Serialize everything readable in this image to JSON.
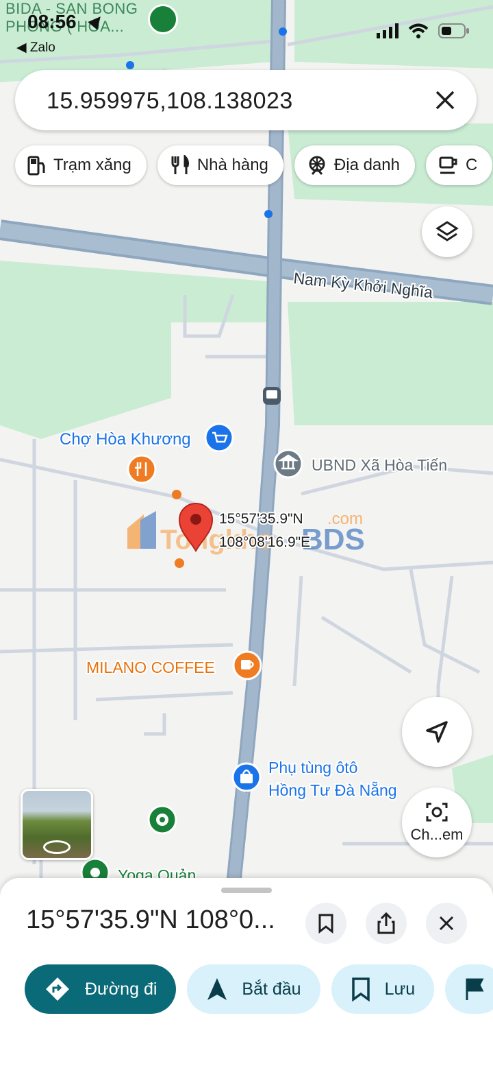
{
  "status_bar": {
    "time": "08:56",
    "back_app": "Zalo",
    "top_poi": [
      "BIDA - SAN BONG",
      "PHONG ( HOA..."
    ]
  },
  "search": {
    "value": "15.959975,108.138023"
  },
  "chips": [
    {
      "label": "Trạm xăng",
      "icon": "gas-station-icon"
    },
    {
      "label": "Nhà hàng",
      "icon": "restaurant-icon"
    },
    {
      "label": "Địa danh",
      "icon": "landmark-icon"
    },
    {
      "label": "C",
      "icon": "cafe-icon"
    }
  ],
  "map": {
    "road_label": "Nam Kỳ Khởi Nghĩa",
    "pin_label": [
      "15°57'35.9\"N",
      "108°08'16.9\"E"
    ],
    "places": [
      {
        "name": "Chợ Hòa Khương",
        "icon": "shopping-cart-icon",
        "color": "#1a73e8"
      },
      {
        "name": "UBND Xã Hòa Tiến",
        "icon": "government-building-icon",
        "color": "#5f6b73"
      },
      {
        "name": "MILANO COFFEE",
        "icon": "coffee-cup-icon",
        "color": "#e8710a"
      },
      {
        "name": "Phụ tùng ôtô",
        "name2": "Hồng Tư Đà Nẵng",
        "icon": "shopping-bag-icon",
        "color": "#1a73e8"
      },
      {
        "name": "Yoga Quản",
        "icon": "place-icon",
        "color": "#188038"
      }
    ],
    "watermark": {
      "left": "Tongkho",
      "right": "BDS",
      "suffix": ".com"
    },
    "colors": {
      "road": "#9fb3c8",
      "land": "#f3f3f1",
      "park": "#c9ecd3",
      "minor_road": "#cfd6e0"
    }
  },
  "controls": {
    "layers": "layers-icon",
    "locate": "navigation-arrow-icon",
    "lens_label": "Ch...em"
  },
  "sheet": {
    "title": "15°57'35.9\"N 108°0...",
    "buttons": [
      {
        "label": "Đường đi",
        "icon": "directions-icon"
      },
      {
        "label": "Bắt đầu",
        "icon": "start-navigation-icon"
      },
      {
        "label": "Lưu",
        "icon": "bookmark-icon"
      }
    ]
  }
}
